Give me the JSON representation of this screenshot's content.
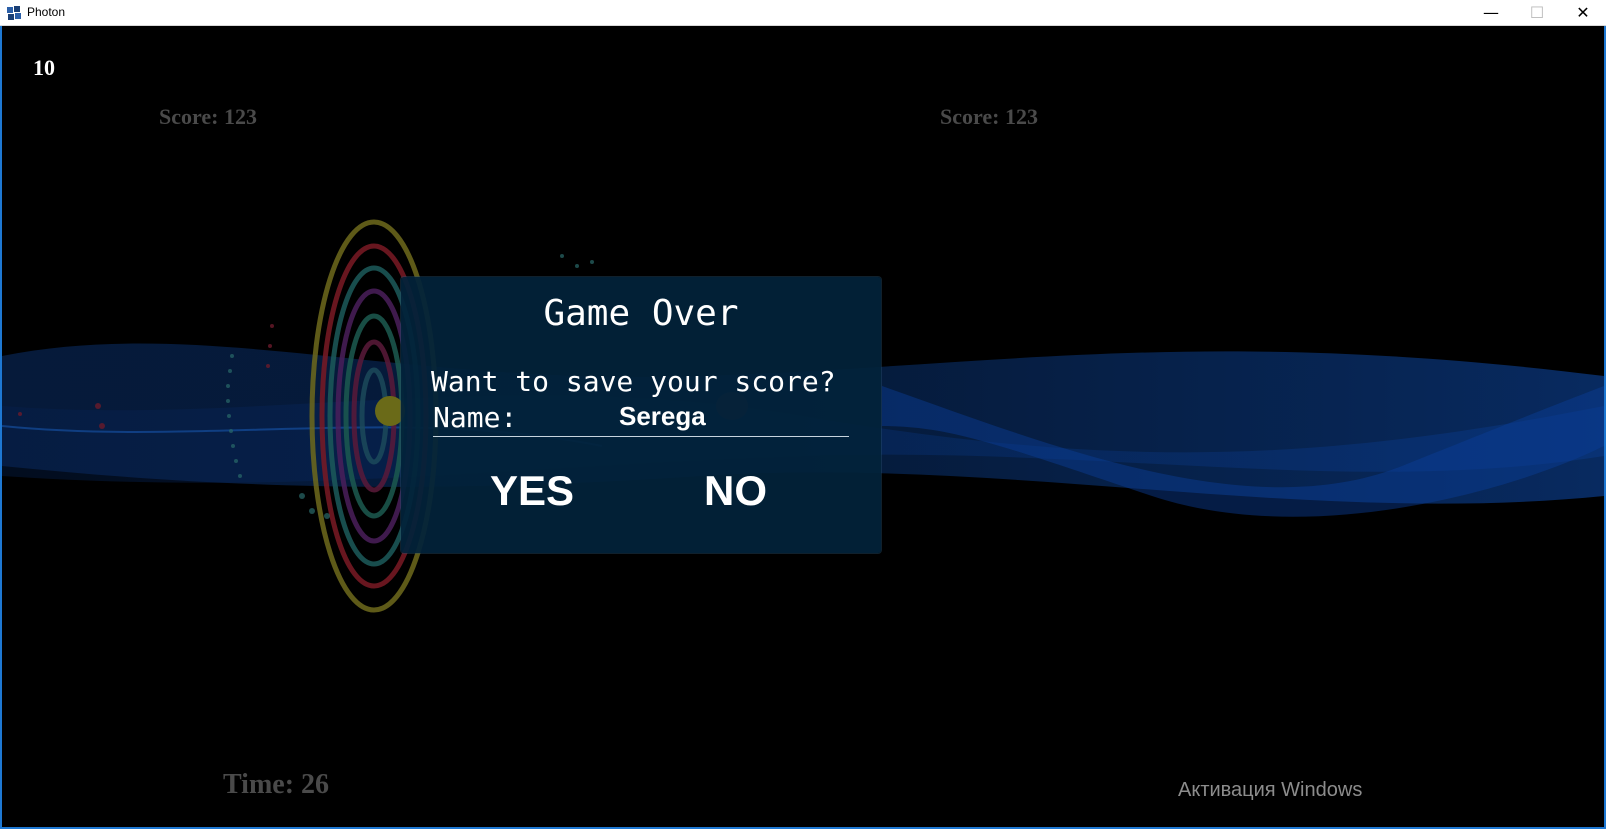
{
  "window": {
    "title": "Photon",
    "minimize_glyph": "—",
    "maximize_glyph": "☐",
    "close_glyph": "✕"
  },
  "hud": {
    "level": "10",
    "score_left": "Score: 123",
    "score_right": "Score: 123",
    "time": "Time: 26"
  },
  "dialog": {
    "title": "Game Over",
    "question": "Want to save your score?",
    "name_label": "Name:",
    "name_value": "Serega",
    "yes_label": "YES",
    "no_label": "NO"
  },
  "watermark": "Активация Windows",
  "colors": {
    "accent": "#1e78d2",
    "dialog_bg": "#02223a",
    "hud_dim": "#4a4a4a"
  }
}
